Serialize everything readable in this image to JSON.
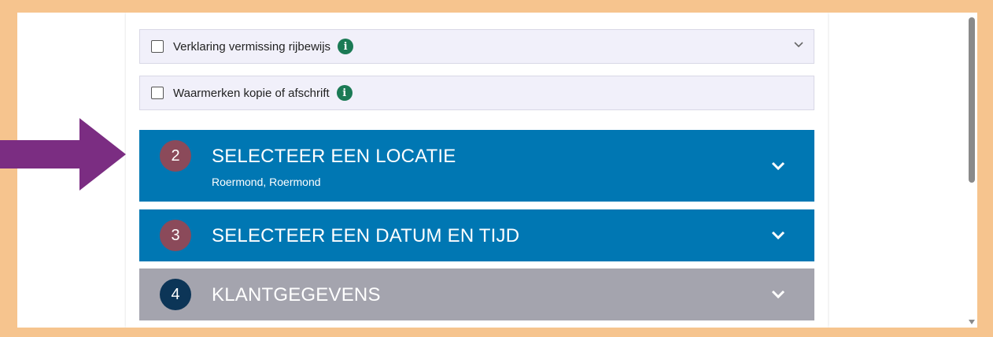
{
  "options": [
    {
      "label": "Verklaring vermissing rijbewijs",
      "checked": false,
      "icon": "info-icon",
      "expandable": true
    },
    {
      "label": "Waarmerken kopie of afschrift",
      "checked": false,
      "icon": "info-icon",
      "expandable": false
    }
  ],
  "steps": [
    {
      "number": "2",
      "title": "SELECTEER EEN LOCATIE",
      "subtitle": "Roermond, Roermond",
      "color": "#0077b3",
      "badge_color": "#8b4a5a"
    },
    {
      "number": "3",
      "title": "SELECTEER EEN DATUM EN TIJD",
      "color": "#0077b3",
      "badge_color": "#8b4a5a"
    },
    {
      "number": "4",
      "title": "KLANTGEGEVENS",
      "color": "#a4a4ae",
      "badge_color": "#0c3557"
    }
  ],
  "info_icon_glyph": "i",
  "colors": {
    "frame": "#f6c48e",
    "annotation_arrow": "#7b2d82",
    "info": "#1b7a55"
  }
}
